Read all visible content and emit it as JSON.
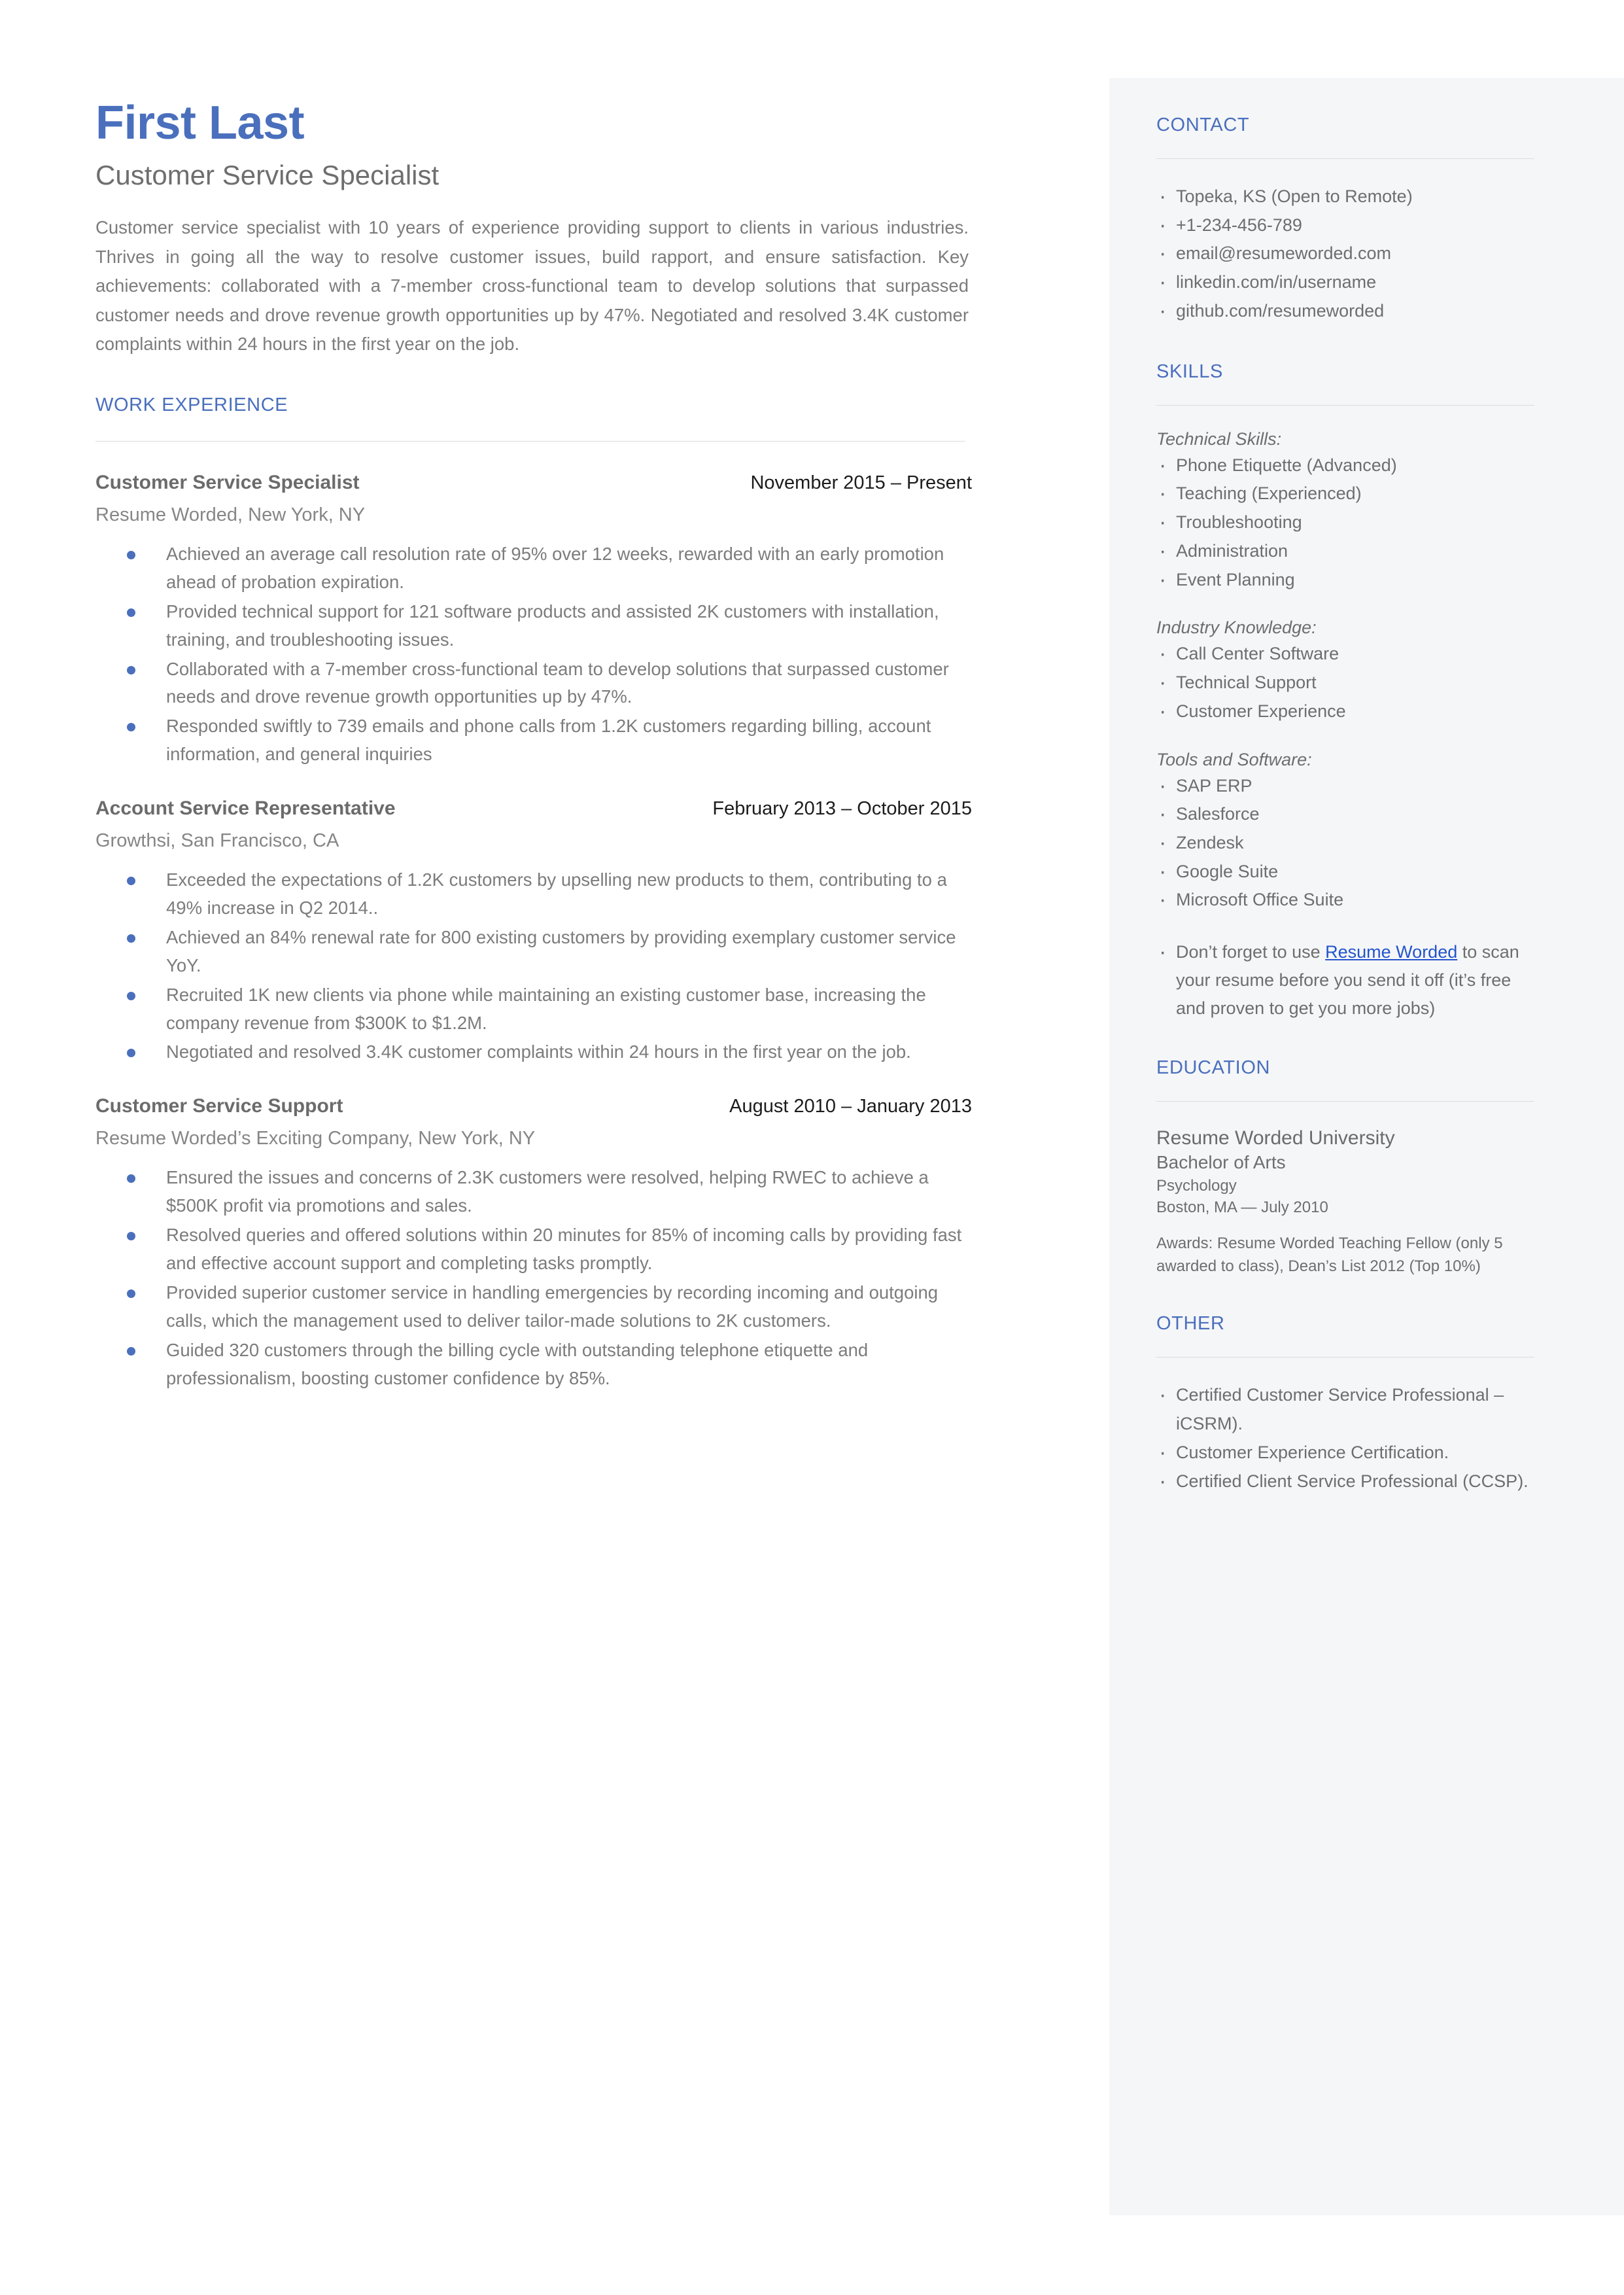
{
  "document_type": "resume",
  "theme": {
    "accent_blue": "#4a6fbd",
    "link_blue": "#2255cc",
    "sidebar_bg": "#f5f6f8",
    "body_text": "#7c7c7c",
    "page_bg": "#ffffff"
  },
  "header": {
    "name": "First Last",
    "headline": "Customer Service Specialist",
    "summary": "Customer service specialist with 10 years of experience providing support to clients in various industries. Thrives in going all the way to resolve customer issues, build rapport, and ensure satisfaction. Key achievements: collaborated with a 7-member cross-functional team to develop solutions that surpassed customer needs and drove revenue growth opportunities up by 47%. Negotiated and resolved 3.4K customer complaints within 24 hours in the first year on the job."
  },
  "work_experience": {
    "section_title": "WORK EXPERIENCE",
    "jobs": [
      {
        "title": "Customer Service Specialist",
        "dates": "November 2015 – Present",
        "company": "Resume Worded, New York, NY",
        "bullets": [
          "Achieved an average call resolution rate of 95% over 12 weeks, rewarded with an early promotion ahead of probation expiration.",
          "Provided technical support for 121 software products and assisted 2K customers with installation, training, and troubleshooting issues.",
          "Collaborated with a 7-member cross-functional team to develop solutions that surpassed customer needs and drove revenue growth opportunities up by 47%.",
          "Responded swiftly to 739 emails and phone calls from 1.2K customers regarding billing, account information, and general inquiries"
        ]
      },
      {
        "title": "Account Service Representative",
        "dates": "February 2013 – October 2015",
        "company": "Growthsi, San Francisco, CA",
        "bullets": [
          "Exceeded the expectations of 1.2K customers by upselling new products to them, contributing to a 49% increase in Q2 2014..",
          "Achieved an 84% renewal rate for 800 existing customers by providing exemplary customer service YoY.",
          "Recruited 1K new clients via phone while maintaining an existing customer base, increasing the company revenue from $300K to $1.2M.",
          "Negotiated and resolved 3.4K customer complaints within 24 hours in the first year on the job."
        ]
      },
      {
        "title": "Customer Service Support",
        "dates": "August 2010 – January 2013",
        "company": "Resume Worded’s Exciting Company, New York, NY",
        "bullets": [
          "Ensured the issues and concerns of 2.3K customers were resolved, helping RWEC to achieve a $500K profit via promotions and sales.",
          "Resolved queries and offered solutions within 20 minutes for 85% of incoming calls by providing fast and effective account support and completing tasks promptly.",
          "Provided superior customer service in handling emergencies by recording incoming and outgoing calls, which the management used to deliver tailor-made solutions to 2K customers.",
          "Guided 320 customers through the billing cycle with outstanding telephone etiquette and professionalism, boosting customer confidence by 85%."
        ]
      }
    ]
  },
  "sidebar": {
    "contact": {
      "section_title": "CONTACT",
      "items": [
        "Topeka, KS (Open to Remote)",
        "+1-234-456-789",
        "email@resumeworded.com",
        "linkedin.com/in/username",
        "github.com/resumeworded"
      ]
    },
    "skills": {
      "section_title": "SKILLS",
      "groups": [
        {
          "label": "Technical Skills:",
          "items": [
            "Phone Etiquette (Advanced)",
            "Teaching (Experienced)",
            "Troubleshooting",
            "Administration",
            "Event Planning"
          ]
        },
        {
          "label": "Industry Knowledge:",
          "items": [
            "Call Center Software",
            "Technical Support",
            "Customer Experience"
          ]
        },
        {
          "label": "Tools and Software:",
          "items": [
            "SAP ERP",
            "Salesforce",
            "Zendesk",
            "Google Suite",
            "Microsoft Office Suite"
          ]
        }
      ],
      "promo": {
        "before_link": "Don’t forget to use ",
        "link_text": "Resume Worded",
        "after_link": " to scan your resume before you send it off (it’s free and proven to get you more jobs)"
      }
    },
    "education": {
      "section_title": "EDUCATION",
      "school": "Resume Worded University",
      "degree": "Bachelor of Arts",
      "field": "Psychology",
      "location_date": "Boston, MA — July 2010",
      "awards": "Awards: Resume Worded Teaching Fellow (only 5 awarded to class), Dean’s List 2012 (Top 10%)"
    },
    "other": {
      "section_title": "OTHER",
      "items": [
        "Certified Customer Service Professional – iCSRM).",
        "Customer Experience Certification.",
        "Certified Client Service Professional (CCSP)."
      ]
    }
  }
}
